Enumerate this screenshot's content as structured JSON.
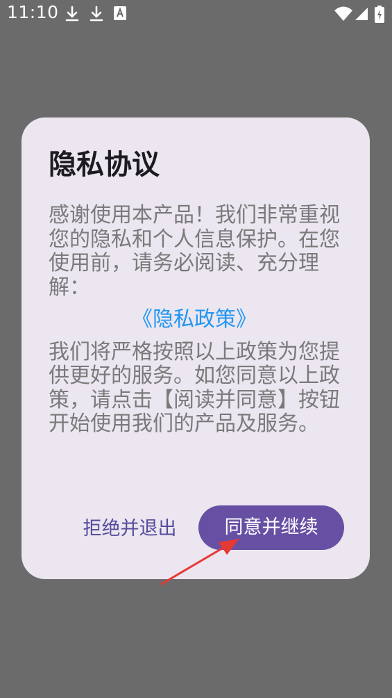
{
  "status_bar": {
    "time": "11:10",
    "icons": [
      "download-icon",
      "download-icon",
      "text-a-icon",
      "wifi-icon",
      "signal-icon",
      "battery-charging-icon"
    ]
  },
  "dialog": {
    "title": "隐私协议",
    "body_intro": "感谢使用本产品！我们非常重视您的隐私和个人信息保护。在您使用前，请务必阅读、充分理解：",
    "policy_link": "《隐私政策》",
    "body_outro": "我们将严格按照以上政策为您提供更好的服务。如您同意以上政策，请点击【阅读并同意】按钮开始使用我们的产品及服务。",
    "decline_label": "拒绝并退出",
    "accept_label": "同意并继续"
  },
  "colors": {
    "scrim": "#6b6b6b",
    "dialog_bg": "#ebe6ef",
    "title": "#1c1b1f",
    "body_text": "#7a7a7a",
    "link": "#2196f3",
    "primary": "#6750a4",
    "annotation": "#e53935"
  }
}
